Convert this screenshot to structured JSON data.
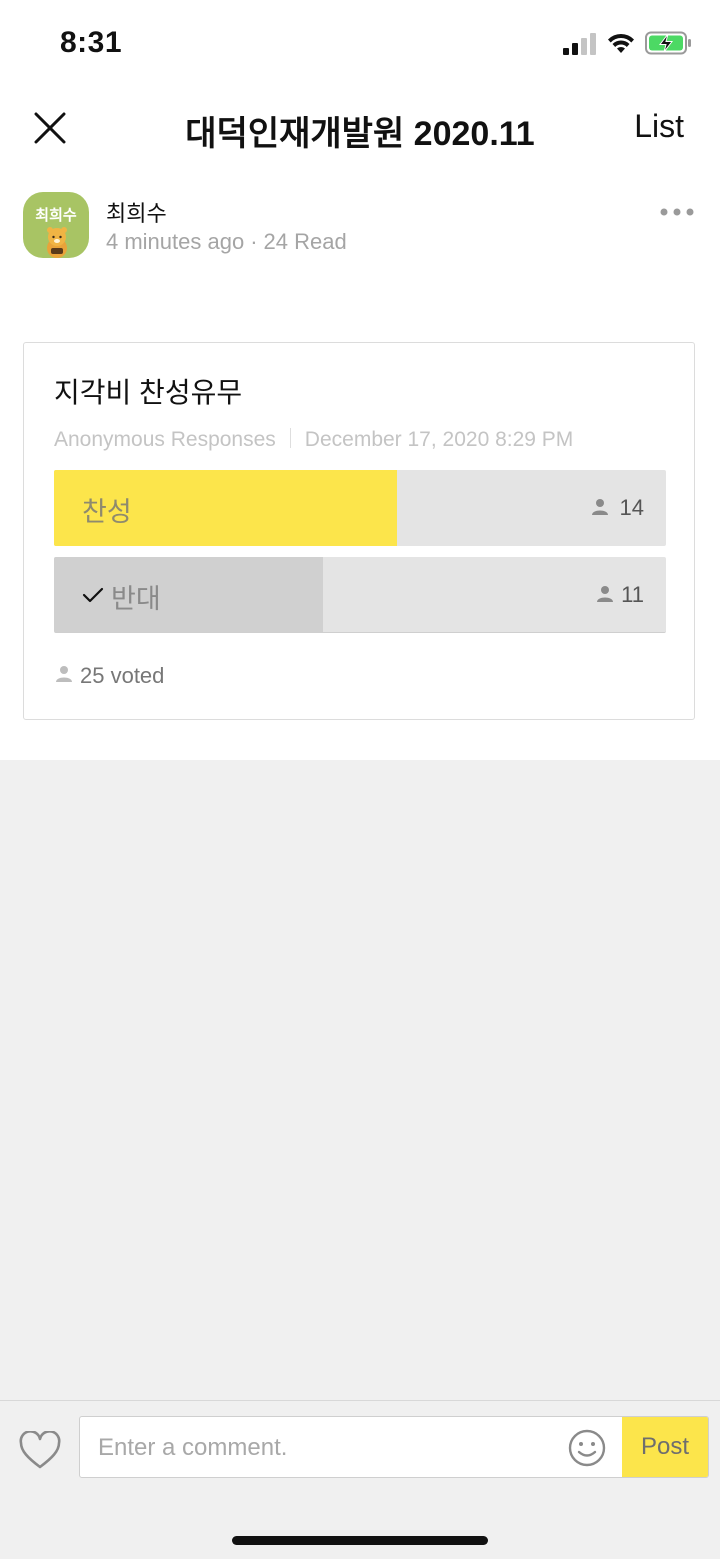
{
  "status_bar": {
    "time": "8:31",
    "icons": [
      "cellular-signal-icon",
      "wifi-icon",
      "battery-charging-icon"
    ],
    "battery_color": "#4cd964"
  },
  "nav": {
    "title": "대덕인재개발원 2020.11",
    "list_label": "List",
    "close_icon": "close-icon"
  },
  "post": {
    "author": {
      "name": "최희수",
      "avatar_text": "최희수",
      "avatar_color": "#a8c464"
    },
    "time_ago": "4 minutes ago",
    "read_count": "24 Read",
    "more_icon": "more-horizontal-icon"
  },
  "poll": {
    "title": "지각비 찬성유무",
    "mode": "Anonymous Responses",
    "date": "December 17, 2020 8:29 PM",
    "options": [
      {
        "label": "찬성",
        "count": "14",
        "share": 0.56,
        "selected": false,
        "fill_color": "#fce54b"
      },
      {
        "label": "반대",
        "count": "11",
        "share": 0.44,
        "selected": true,
        "fill_color": "#d0d0d0"
      }
    ],
    "voted_text": "25 voted"
  },
  "comment_bar": {
    "placeholder": "Enter a comment.",
    "post_label": "Post",
    "accent_color": "#fce54b",
    "heart_icon": "heart-outline-icon",
    "emoji_icon": "smiley-icon"
  }
}
